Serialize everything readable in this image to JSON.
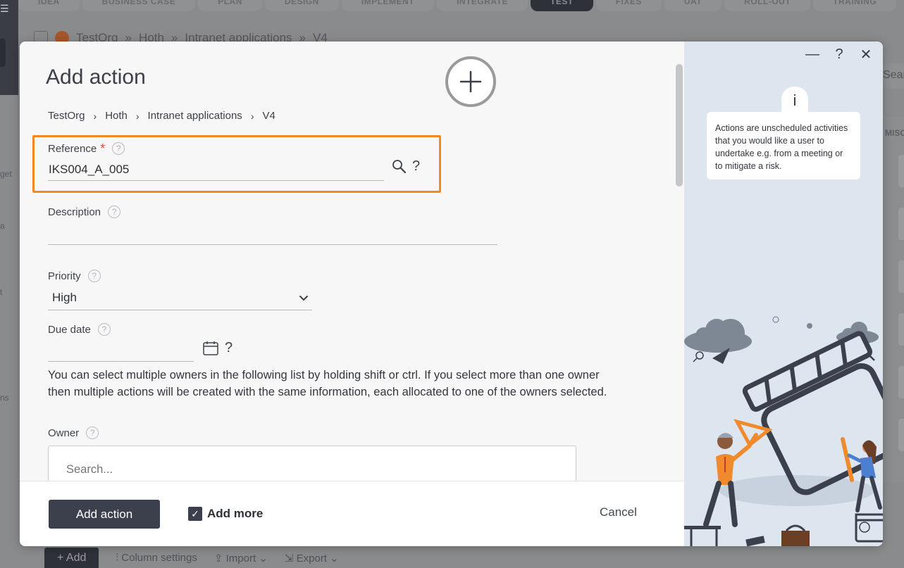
{
  "background": {
    "tabs": [
      "IDEA",
      "BUSINESS CASE",
      "PLAN",
      "DESIGN",
      "IMPLEMENT",
      "INTEGRATE",
      "TEST",
      "FIXES",
      "UAT",
      "ROLL-OUT",
      "TRAINING"
    ],
    "active_tab": "TEST",
    "breadcrumb": [
      "TestOrg",
      "Hoth",
      "Intranet applications",
      "V4"
    ],
    "right_partial": "Search",
    "right_section": "MISC",
    "left_partials": [
      "get",
      "a",
      "t",
      "ns"
    ],
    "bottom_tools": {
      "add": "Add",
      "column_settings": "Column settings",
      "import": "Import",
      "export": "Export"
    }
  },
  "modal": {
    "title": "Add action",
    "breadcrumb": [
      "TestOrg",
      "Hoth",
      "Intranet applications",
      "V4"
    ],
    "reference": {
      "label": "Reference",
      "required_mark": "*",
      "value": "IKS004_A_005",
      "help": "?"
    },
    "description": {
      "label": "Description",
      "value": ""
    },
    "priority": {
      "label": "Priority",
      "value": "High"
    },
    "due_date": {
      "label": "Due date",
      "value": "",
      "help": "?"
    },
    "owner_note": "You can select multiple owners in the following list by holding shift or ctrl. If you select more than one owner then multiple actions will be created with the same information, each allocated to one of the owners selected.",
    "owner": {
      "label": "Owner",
      "search_placeholder": "Search..."
    },
    "help_glyph": "?",
    "footer": {
      "submit_label": "Add action",
      "add_more_label": "Add more",
      "add_more_checked": true,
      "checkmark": "✓",
      "cancel_label": "Cancel"
    }
  },
  "side_panel": {
    "info_icon": "i",
    "info_text": "Actions are unscheduled activities that you would like a user to undertake e.g. from a meeting or to mitigate a risk.",
    "window_controls": {
      "minimize": "—",
      "help": "?",
      "close": "✕"
    }
  },
  "colors": {
    "accent_orange": "#f18a1f",
    "primary_button": "#3b404c",
    "side_panel_bg": "#dde5ef"
  }
}
